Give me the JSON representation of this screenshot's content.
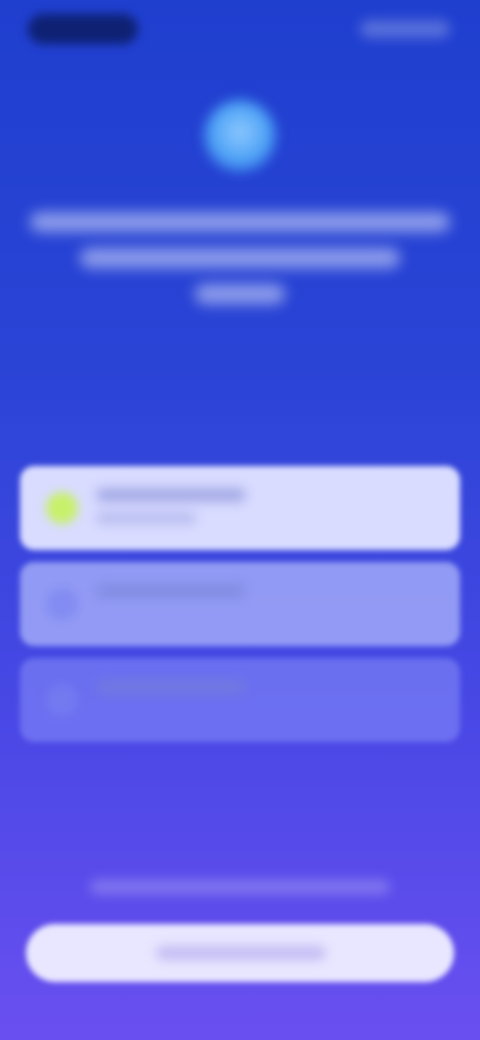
{
  "status_bar": {
    "icons": [
      "time-pill",
      "signal-icon",
      "battery-icon"
    ]
  },
  "hero": {
    "icon": "brand-globe-icon"
  },
  "options": [
    {
      "state": "selected",
      "icon": "check-circle-icon"
    },
    {
      "state": "default",
      "icon": "circle-icon"
    },
    {
      "state": "default",
      "icon": "circle-icon"
    }
  ],
  "colors": {
    "background_top": "#1f3fcf",
    "background_bottom": "#6a4ff0",
    "selected_card": "#d9dcff",
    "selected_icon": "#c8f06a",
    "primary_button": "#e9e7ff"
  }
}
